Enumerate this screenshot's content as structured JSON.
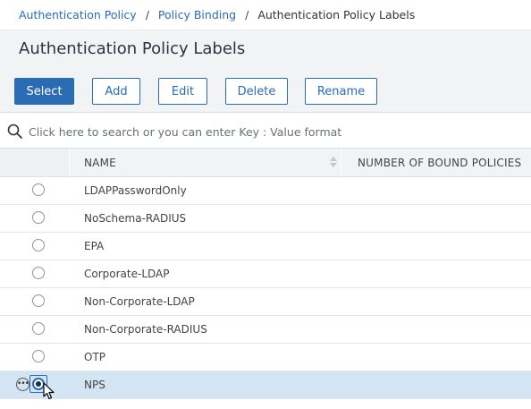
{
  "breadcrumb": {
    "items": [
      "Authentication Policy",
      "Policy Binding"
    ],
    "separator": "/",
    "current": "Authentication Policy Labels"
  },
  "page_title": "Authentication Policy Labels",
  "toolbar": {
    "select_label": "Select",
    "add_label": "Add",
    "edit_label": "Edit",
    "delete_label": "Delete",
    "rename_label": "Rename"
  },
  "search": {
    "placeholder": "Click here to search or you can enter Key : Value format"
  },
  "table": {
    "columns": [
      "NAME",
      "NUMBER OF BOUND POLICIES"
    ],
    "rows": [
      {
        "name": "LDAPPasswordOnly",
        "bound": ""
      },
      {
        "name": "NoSchema-RADIUS",
        "bound": ""
      },
      {
        "name": "EPA",
        "bound": ""
      },
      {
        "name": "Corporate-LDAP",
        "bound": ""
      },
      {
        "name": "Non-Corporate-LDAP",
        "bound": ""
      },
      {
        "name": "Non-Corporate-RADIUS",
        "bound": ""
      },
      {
        "name": "OTP",
        "bound": ""
      },
      {
        "name": "NPS",
        "bound": "",
        "selected": true
      }
    ]
  },
  "colors": {
    "accent": "#2a6cb4",
    "selected_row": "#d3e4f3",
    "toolbar_bg": "#f2f3f5"
  }
}
